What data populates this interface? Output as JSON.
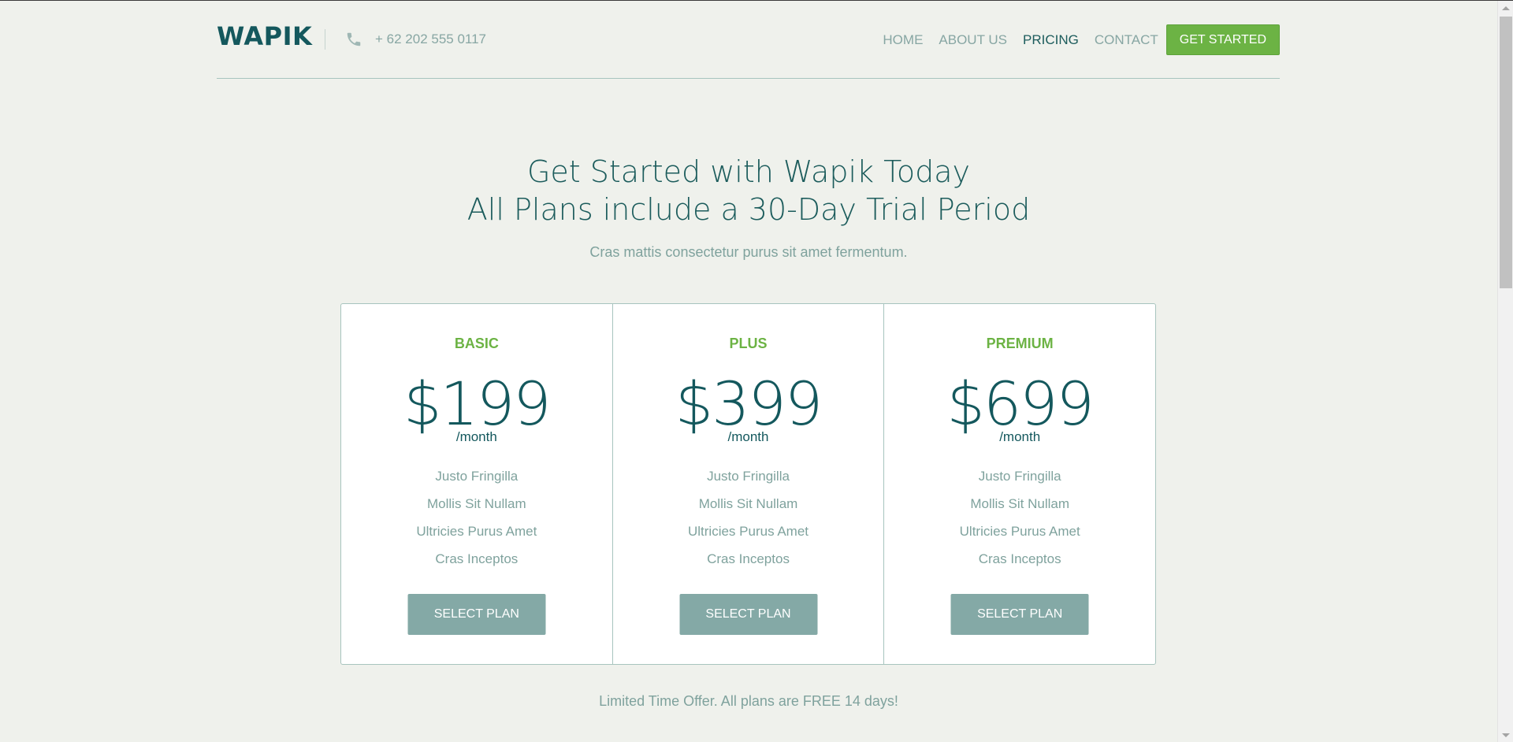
{
  "header": {
    "logo": "WAPIK",
    "phone": "+ 62 202 555 0117",
    "phone_icon": "phone-icon",
    "nav": [
      {
        "label": "HOME"
      },
      {
        "label": "ABOUT US"
      },
      {
        "label": "PRICING"
      },
      {
        "label": "CONTACT"
      }
    ],
    "cta": "GET STARTED"
  },
  "hero": {
    "title_line1": "Get Started with Wapik Today",
    "title_line2": "All Plans include a 30-Day Trial Period",
    "subtitle": "Cras mattis consectetur purus sit amet fermentum."
  },
  "plans": [
    {
      "name": "BASIC",
      "price": "$199",
      "period": "/month",
      "features": [
        "Justo Fringilla",
        "Mollis Sit Nullam",
        "Ultricies Purus Amet",
        "Cras Inceptos"
      ],
      "button": "SELECT PLAN"
    },
    {
      "name": "PLUS",
      "price": "$399",
      "period": "/month",
      "features": [
        "Justo Fringilla",
        "Mollis Sit Nullam",
        "Ultricies Purus Amet",
        "Cras Inceptos"
      ],
      "button": "SELECT PLAN"
    },
    {
      "name": "PREMIUM",
      "price": "$699",
      "period": "/month",
      "features": [
        "Justo Fringilla",
        "Mollis Sit Nullam",
        "Ultricies Purus Amet",
        "Cras Inceptos"
      ],
      "button": "SELECT PLAN"
    }
  ],
  "offer": "Limited Time Offer. All plans are FREE 14 days!",
  "colors": {
    "brand": "#14585d",
    "accent_green": "#6cb344",
    "muted_text": "#7fa29d",
    "button_gray": "#84a9a6",
    "background": "#eff1ec"
  }
}
